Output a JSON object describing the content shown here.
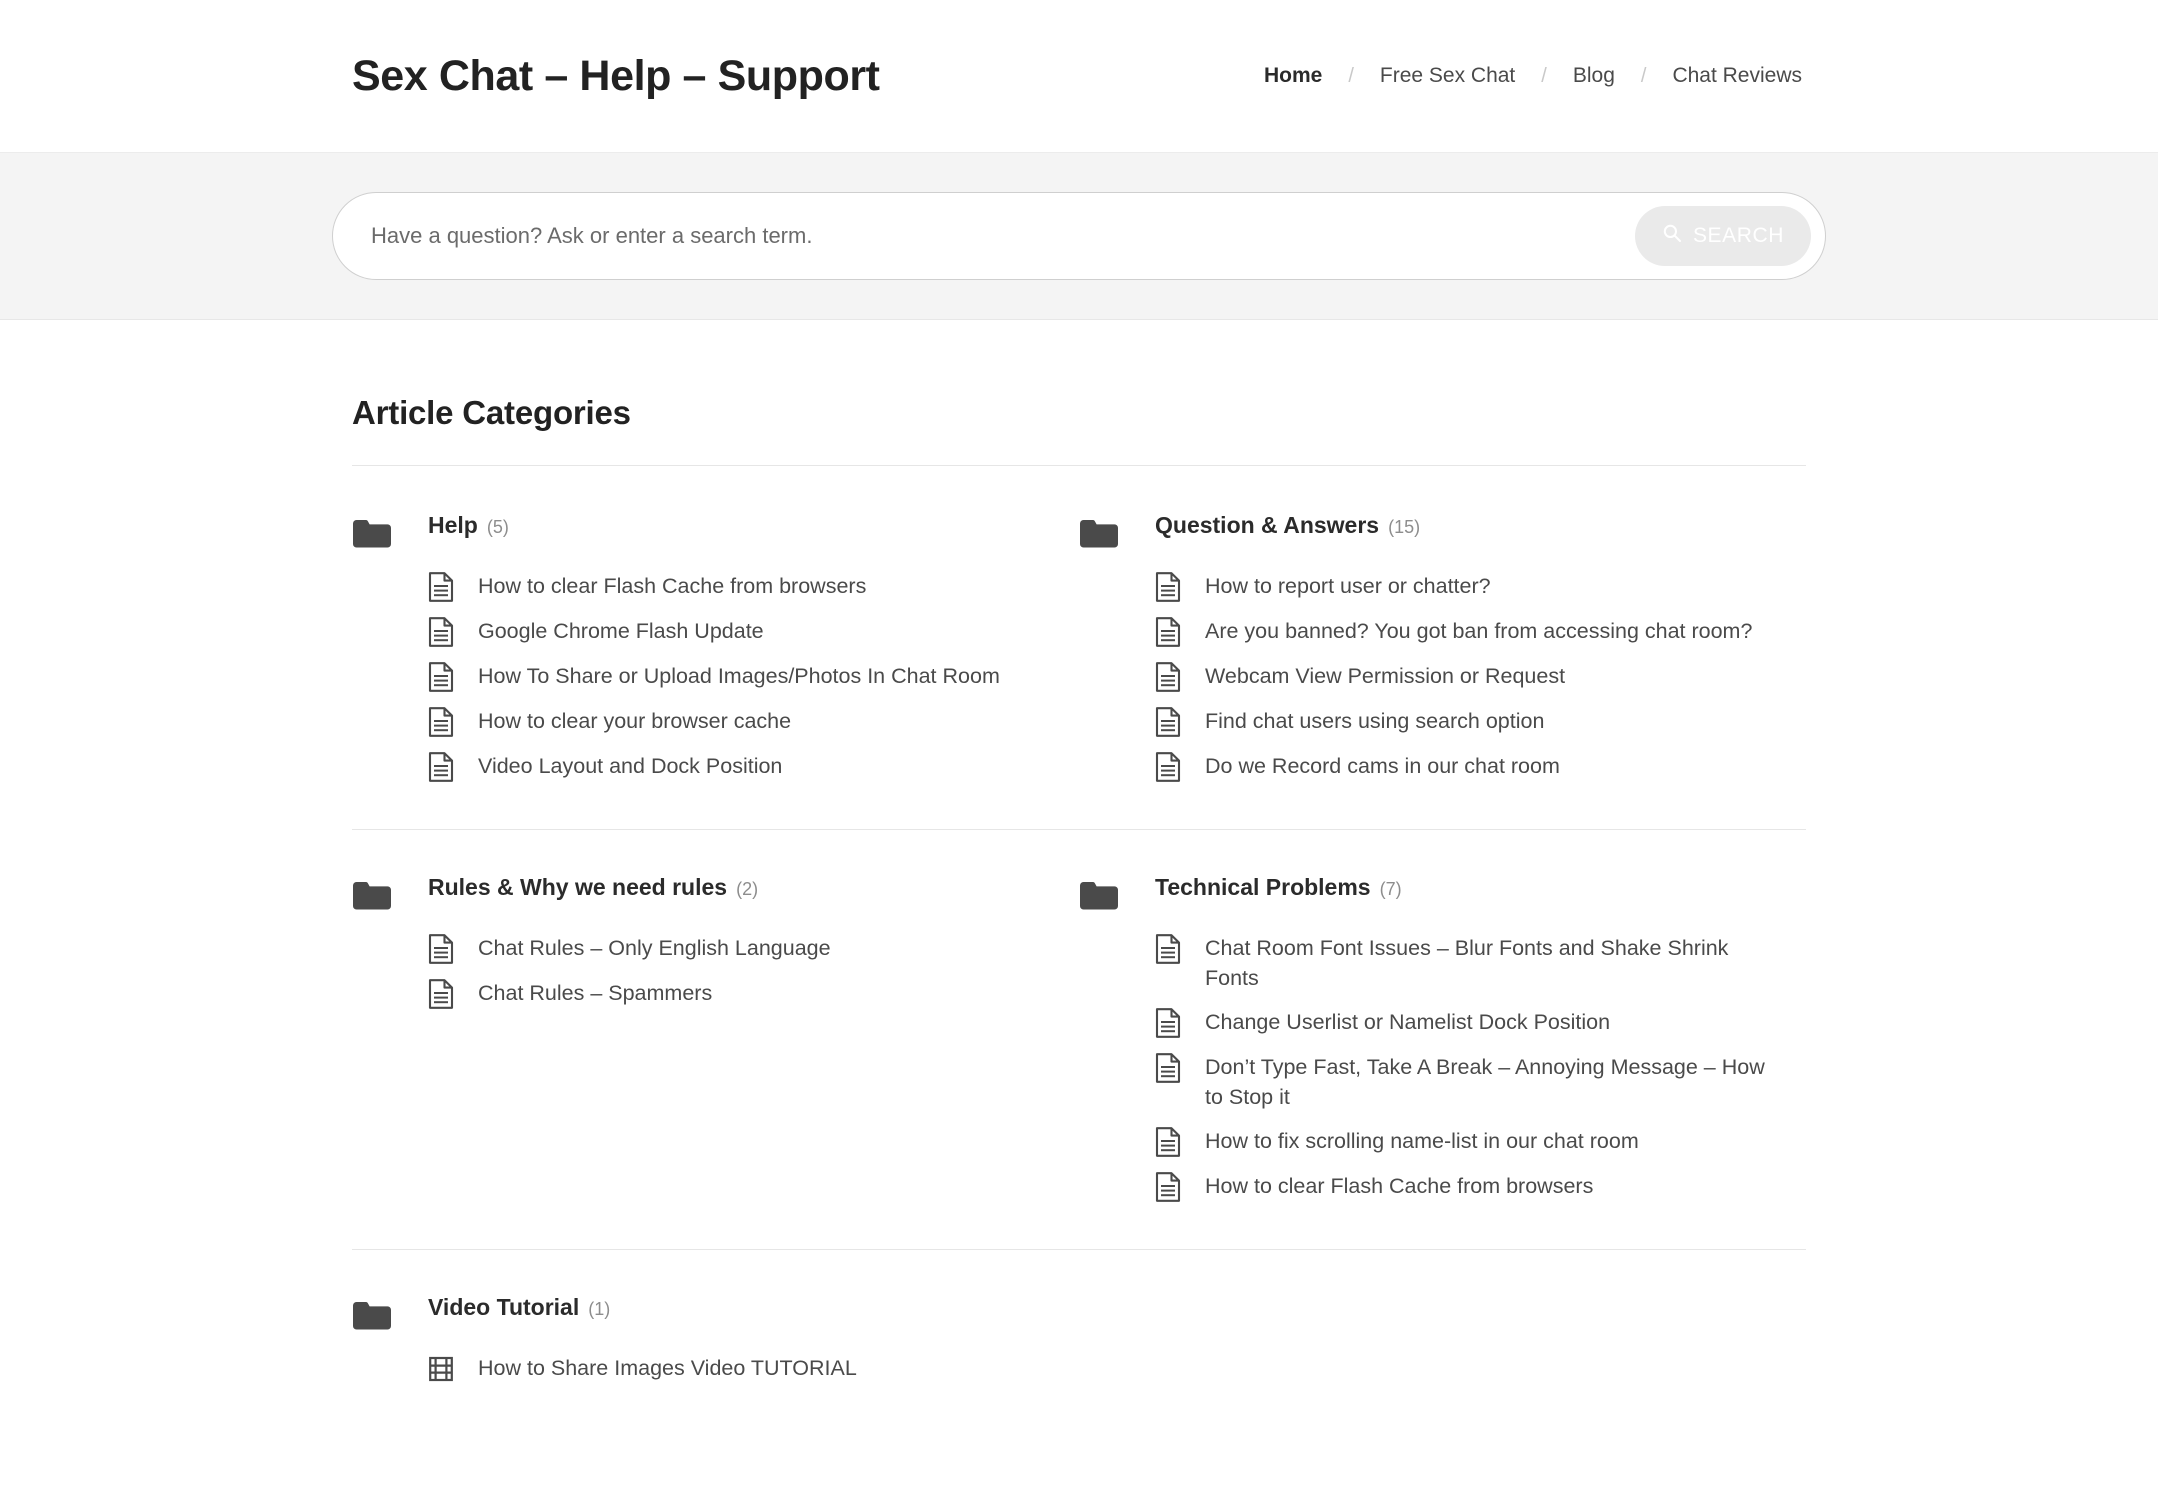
{
  "header": {
    "site_title": "Sex Chat – Help – Support",
    "nav": [
      {
        "label": "Home",
        "active": true
      },
      {
        "label": "Free Sex Chat",
        "active": false
      },
      {
        "label": "Blog",
        "active": false
      },
      {
        "label": "Chat Reviews",
        "active": false
      }
    ],
    "nav_separator": "/"
  },
  "search": {
    "placeholder": "Have a question? Ask or enter a search term.",
    "value": "",
    "button_label": "SEARCH",
    "button_icon": "search-icon",
    "band_background": "#f4f4f4",
    "button_background": "#eaeaea",
    "button_text_color": "#ffffff"
  },
  "main": {
    "section_title": "Article Categories",
    "categories": [
      {
        "name": "Help",
        "count": "(5)",
        "icon": "folder-icon",
        "articles": [
          {
            "title": "How to clear Flash Cache from browsers",
            "icon": "document-icon"
          },
          {
            "title": "Google Chrome Flash Update",
            "icon": "document-icon"
          },
          {
            "title": "How To Share or Upload Images/Photos In Chat Room",
            "icon": "document-icon"
          },
          {
            "title": "How to clear your browser cache",
            "icon": "document-icon"
          },
          {
            "title": "Video Layout and Dock Position",
            "icon": "document-icon"
          }
        ]
      },
      {
        "name": "Question & Answers",
        "count": "(15)",
        "icon": "folder-icon",
        "articles": [
          {
            "title": "How to report user or chatter?",
            "icon": "document-icon"
          },
          {
            "title": "Are you banned? You got ban from accessing chat room?",
            "icon": "document-icon"
          },
          {
            "title": "Webcam View Permission or Request",
            "icon": "document-icon"
          },
          {
            "title": "Find chat users using search option",
            "icon": "document-icon"
          },
          {
            "title": "Do we Record cams in our chat room",
            "icon": "document-icon"
          }
        ]
      },
      {
        "name": "Rules & Why we need rules",
        "count": "(2)",
        "icon": "folder-icon",
        "articles": [
          {
            "title": "Chat Rules – Only English Language",
            "icon": "document-icon"
          },
          {
            "title": "Chat Rules – Spammers",
            "icon": "document-icon"
          }
        ]
      },
      {
        "name": "Technical Problems",
        "count": "(7)",
        "icon": "folder-icon",
        "articles": [
          {
            "title": "Chat Room Font Issues – Blur Fonts and Shake Shrink Fonts",
            "icon": "document-icon"
          },
          {
            "title": "Change Userlist or Namelist Dock Position",
            "icon": "document-icon"
          },
          {
            "title": "Don’t Type Fast, Take A Break – Annoying Message – How to Stop it",
            "icon": "document-icon"
          },
          {
            "title": "How to fix scrolling name-list in our chat room",
            "icon": "document-icon"
          },
          {
            "title": "How to clear Flash Cache from browsers",
            "icon": "document-icon"
          }
        ]
      },
      {
        "name": "Video Tutorial",
        "count": "(1)",
        "icon": "folder-icon",
        "articles": [
          {
            "title": "How to Share Images Video TUTORIAL",
            "icon": "film-icon"
          }
        ]
      }
    ]
  },
  "colors": {
    "text_dark": "#222222",
    "text_body": "#4a4a4a",
    "muted": "#8d8d8d",
    "divider": "#e6e6e6",
    "icon_dark": "#4a4a4a"
  }
}
